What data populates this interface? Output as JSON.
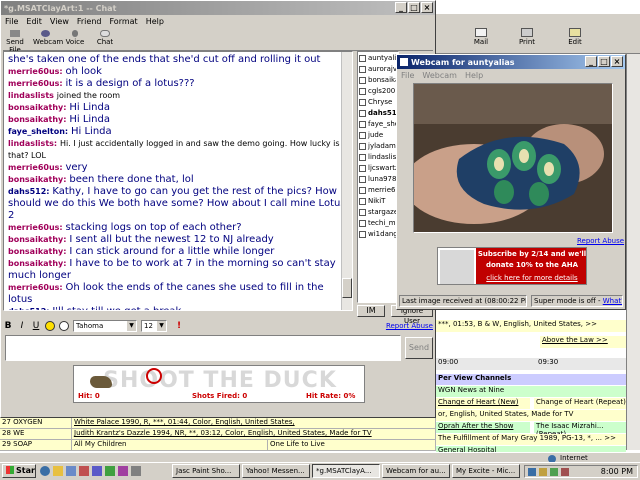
{
  "chat_window": {
    "title": "*g.MSATClayArt:1 -- Chat",
    "menu": [
      "File",
      "Edit",
      "View",
      "Friend",
      "Format",
      "Help"
    ],
    "toolbar": [
      "Send File",
      "Webcam",
      "Voice",
      "Chat"
    ],
    "messages": [
      {
        "nick": "",
        "text": "she's taken one of the ends that she'd cut off and rolling it out",
        "nick_color": "pink"
      },
      {
        "nick": "merrie60us:",
        "text": "oh look",
        "nick_color": "pink"
      },
      {
        "nick": "merrie60us:",
        "text": "it is a design of a lotus???",
        "nick_color": "pink"
      },
      {
        "nick": "lindaslists",
        "text": "joined the room",
        "system": true
      },
      {
        "nick": "bonsaikathy:",
        "text": "Hi Linda",
        "nick_color": "pink"
      },
      {
        "nick": "bonsaikathy:",
        "text": "Hi Linda",
        "nick_color": "pink"
      },
      {
        "nick": "faye_shelton:",
        "text": "Hi Linda",
        "nick_color": "blue"
      },
      {
        "nick": "lindaslists:",
        "text": "Hi. I just accidentally logged in and saw the demo going. How lucky is that? LOL",
        "nick_color": "pink",
        "small": true
      },
      {
        "nick": "merrie60us:",
        "text": "very",
        "nick_color": "pink"
      },
      {
        "nick": "bonsaikathy:",
        "text": "been there done that, lol",
        "nick_color": "pink"
      },
      {
        "nick": "dahs512:",
        "text": "Kathy, I have to go can you get the rest of the pics? How should we do this We both have some? How about I call mine Lotus 2",
        "nick_color": "blue"
      },
      {
        "nick": "merrie60us:",
        "text": "stacking logs on top of each other?",
        "nick_color": "pink"
      },
      {
        "nick": "bonsaikathy:",
        "text": "I sent all but the newest 12 to NJ already",
        "nick_color": "pink"
      },
      {
        "nick": "bonsaikathy:",
        "text": "I can stick around for a little while longer",
        "nick_color": "pink"
      },
      {
        "nick": "bonsaikathy:",
        "text": "I have to be to work at 7 in the morning so can't stay much longer",
        "nick_color": "pink"
      },
      {
        "nick": "merrie60us:",
        "text": "Oh look the ends of the canes she used to fill in the lotus",
        "nick_color": "pink"
      },
      {
        "nick": "dahs512:",
        "text": "I'll stay till we get a break",
        "nick_color": "blue"
      }
    ],
    "users": [
      "auntyalias",
      "aurorajv",
      "bonsaikath",
      "cgls2001",
      "Chryse",
      "dahs512",
      "faye_shel",
      "jude",
      "jyladams",
      "lindaslists",
      "ljcswartz",
      "luna9786",
      "merrie60u",
      "NikiT",
      "stargazer",
      "techi_mor",
      "wi1dangl"
    ],
    "im_button": "IM",
    "ignore_button": "Ignore User",
    "report_abuse": "Report Abuse",
    "format_font": "Tahoma",
    "format_size": "12",
    "send_button": "Send"
  },
  "game_ad": {
    "title": "SHOOT THE DUCK",
    "hit": "Hit: 0",
    "shots": "Shots Fired: 0",
    "rate": "Hit Rate: 0%"
  },
  "webcam_window": {
    "title": "Webcam for auntyalias",
    "menu": [
      "File",
      "Webcam",
      "Help"
    ],
    "report_abuse": "Report Abuse",
    "ad_line1": "Subscribe by 2/14 and we'll",
    "ad_line2": "donate 10% to the AHA",
    "ad_cta": "click here for more details",
    "status_left": "Last image received at (08:00:22 PM)",
    "status_right_label": "Super mode is off -",
    "status_right_link": "What's this?"
  },
  "outlook_toolbar": {
    "items": [
      "Mail",
      "Print",
      "Edit"
    ]
  },
  "tv_listings": {
    "right_rows": [
      "***, 01:53, B & W, English, United States, >>",
      "Above the Law >>",
      "",
      "09:00",
      "09:30",
      "Per View Channels",
      "WGN News at Nine",
      "Change of Heart (New)",
      "Change of Heart (Repeat)",
      "or, English, United States, Made for TV",
      "Oprah After the Show",
      "The Isaac Mizrahi... (Repeat)",
      "The Fulfillment of Mary Gray 1989, PG-13, *, ... >>",
      "General Hospital"
    ],
    "bottom_rows": [
      {
        "ch": "27 OXYGEN",
        "show": "White Palace 1990, R, ***, 01:44, Color, English, United States,"
      },
      {
        "ch": "28 WE",
        "show": "Judith Krantz's Dazzle 1994, NR, **, 03:12, Color, English, United States, Made for TV"
      },
      {
        "ch": "29 SOAP",
        "show": "All My Children",
        "extra": "One Life to Live"
      }
    ]
  },
  "taskbar": {
    "start": "Start",
    "tasks": [
      "Jasc Paint Sho...",
      "Yahoo! Messen...",
      "*g.MSATClayA...",
      "Webcam for au...",
      "My Excite - Mic..."
    ],
    "tray_status": "Internet",
    "time": "8:00 PM"
  }
}
